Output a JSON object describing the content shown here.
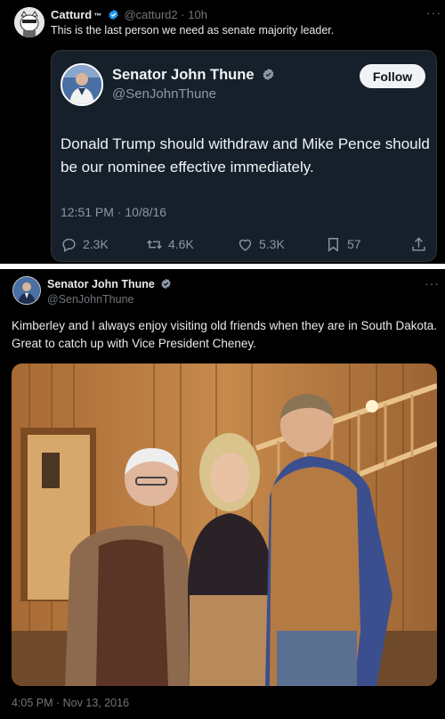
{
  "tweet1": {
    "name": "Catturd",
    "tm": "™",
    "handle": "@catturd2",
    "time": "10h",
    "separator": "·",
    "text": "This is the last person we need as senate majority leader."
  },
  "quote": {
    "name": "Senator John Thune",
    "handle": "@SenJohnThune",
    "follow_label": "Follow",
    "text": "Donald Trump should withdraw and Mike Pence should be our nominee effective immediately.",
    "timestamp": "12:51 PM · 10/8/16",
    "replies": "2.3K",
    "retweets": "4.6K",
    "likes": "5.3K",
    "bookmarks": "57"
  },
  "tweet2": {
    "name": "Senator John Thune",
    "handle": "@SenJohnThune",
    "text": "Kimberley and I always enjoy visiting old friends when they are in South Dakota. Great to catch up with Vice President Cheney.",
    "timestamp": "4:05 PM · Nov 13, 2016"
  },
  "more_glyph": "···",
  "colors": {
    "verified_blue": "#1d9bf0",
    "card_bg": "#15202b",
    "muted": "#71767b"
  },
  "icons": [
    "reply-icon",
    "retweet-icon",
    "like-icon",
    "bookmark-icon",
    "share-icon",
    "verified-badge-icon",
    "more-icon"
  ]
}
